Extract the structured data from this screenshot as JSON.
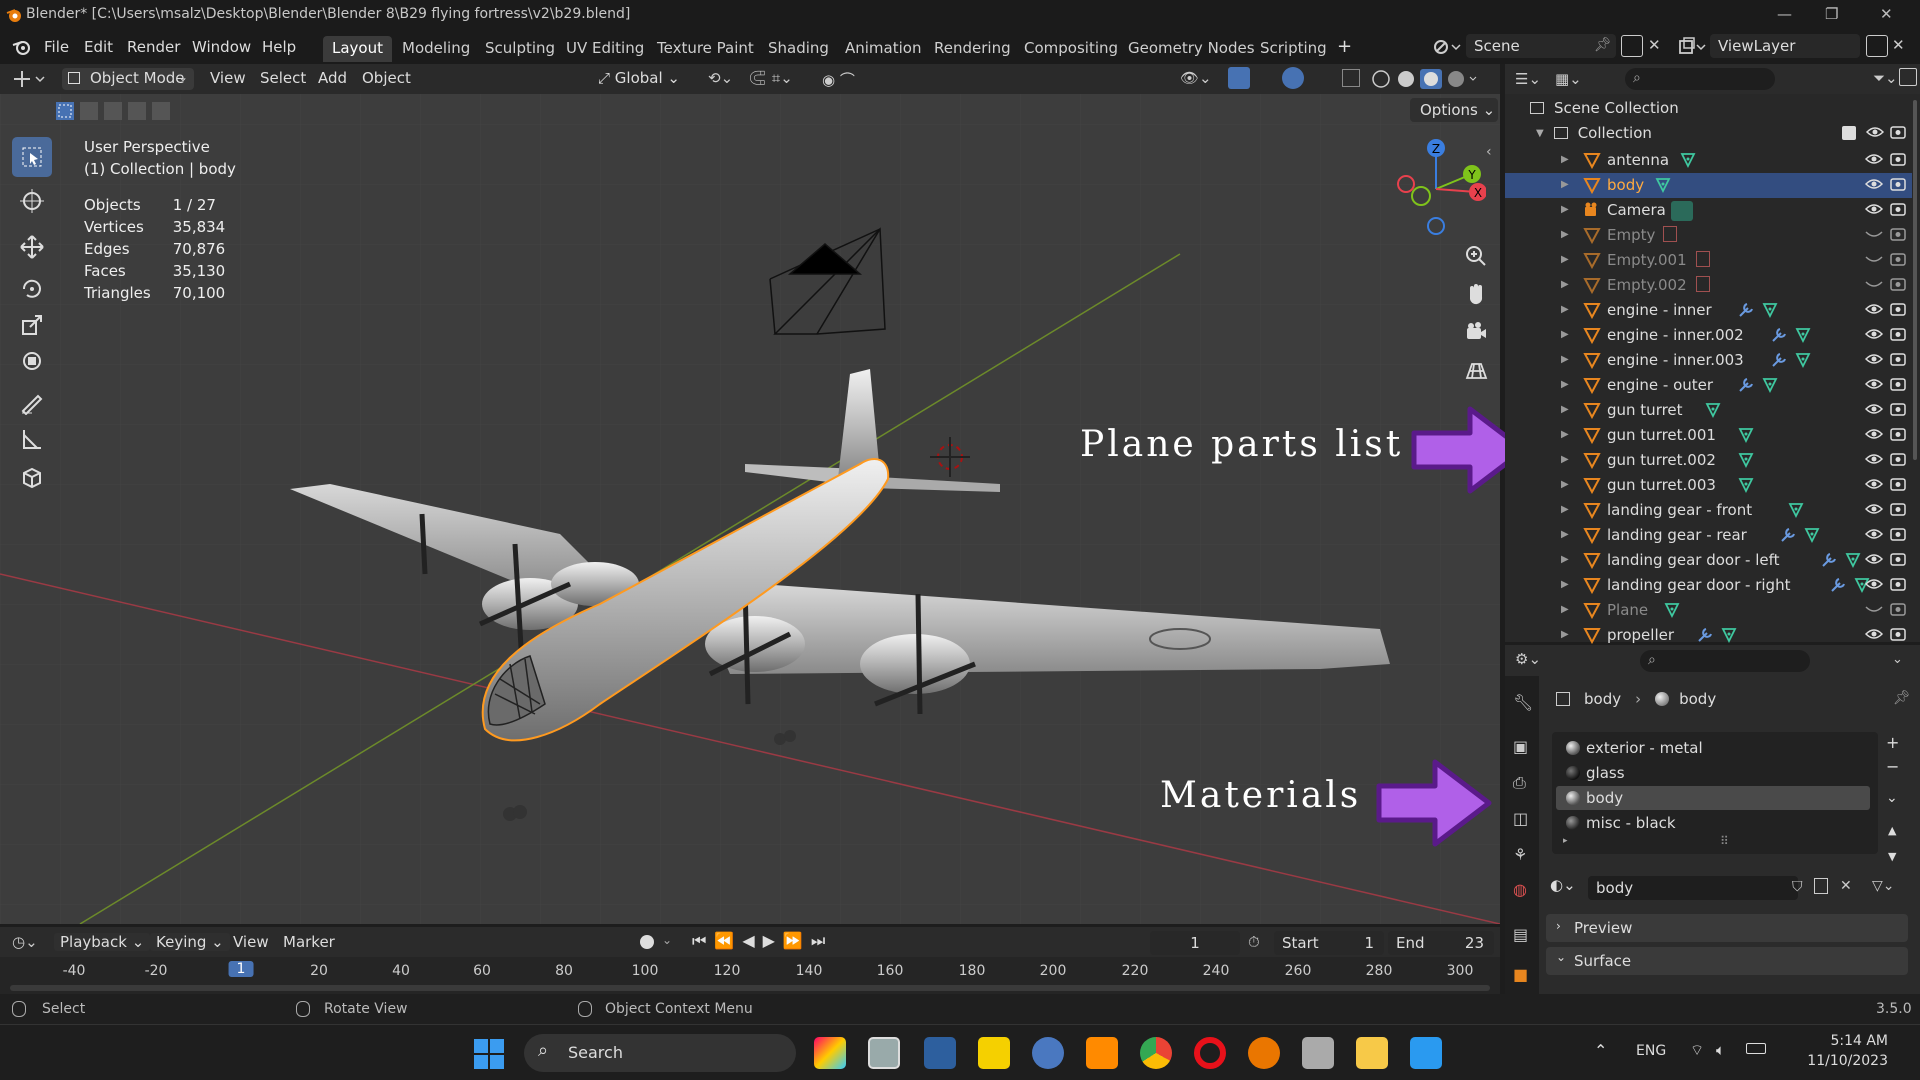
{
  "window": {
    "title": "Blender* [C:\\Users\\msalz\\Desktop\\Blender\\Blender 8\\B29 flying fortress\\v2\\b29.blend]"
  },
  "menu": [
    "File",
    "Edit",
    "Render",
    "Window",
    "Help"
  ],
  "workspaces": [
    "Layout",
    "Modeling",
    "Sculpting",
    "UV Editing",
    "Texture Paint",
    "Shading",
    "Animation",
    "Rendering",
    "Compositing",
    "Geometry Nodes",
    "Scripting"
  ],
  "scene": "Scene",
  "view_layer": "ViewLayer",
  "viewport_header": {
    "mode": "Object Mode",
    "menus": [
      "View",
      "Select",
      "Add",
      "Object"
    ],
    "transform": "Global",
    "options": "Options"
  },
  "overlay_info": {
    "perspective": "User Perspective",
    "collection": "(1) Collection | body",
    "stats": [
      {
        "label": "Objects",
        "value": "1 / 27"
      },
      {
        "label": "Vertices",
        "value": "35,834"
      },
      {
        "label": "Edges",
        "value": "70,876"
      },
      {
        "label": "Faces",
        "value": "35,130"
      },
      {
        "label": "Triangles",
        "value": "70,100"
      }
    ]
  },
  "gizmo_axes": {
    "x": "X",
    "y": "Y",
    "z": "Z"
  },
  "annotations": {
    "parts": "Plane parts list",
    "materials": "Materials"
  },
  "outliner": {
    "root": "Scene Collection",
    "collection": "Collection",
    "items": [
      {
        "name": "antenna",
        "type": "mesh",
        "selected": false,
        "dim": false
      },
      {
        "name": "body",
        "type": "mesh",
        "selected": true,
        "dim": false
      },
      {
        "name": "Camera",
        "type": "camera",
        "selected": false,
        "dim": false
      },
      {
        "name": "Empty",
        "type": "empty",
        "selected": false,
        "dim": true
      },
      {
        "name": "Empty.001",
        "type": "empty",
        "selected": false,
        "dim": true
      },
      {
        "name": "Empty.002",
        "type": "empty",
        "selected": false,
        "dim": true
      },
      {
        "name": "engine - inner",
        "type": "mesh-mod",
        "selected": false,
        "dim": false
      },
      {
        "name": "engine - inner.002",
        "type": "mesh-mod",
        "selected": false,
        "dim": false
      },
      {
        "name": "engine - inner.003",
        "type": "mesh-mod",
        "selected": false,
        "dim": false
      },
      {
        "name": "engine - outer",
        "type": "mesh-mod",
        "selected": false,
        "dim": false
      },
      {
        "name": "gun turret",
        "type": "mesh",
        "selected": false,
        "dim": false
      },
      {
        "name": "gun turret.001",
        "type": "mesh",
        "selected": false,
        "dim": false
      },
      {
        "name": "gun turret.002",
        "type": "mesh",
        "selected": false,
        "dim": false
      },
      {
        "name": "gun turret.003",
        "type": "mesh",
        "selected": false,
        "dim": false
      },
      {
        "name": "landing gear - front",
        "type": "mesh",
        "selected": false,
        "dim": false
      },
      {
        "name": "landing gear - rear",
        "type": "mesh-mod",
        "selected": false,
        "dim": false
      },
      {
        "name": "landing gear door - left",
        "type": "mesh-mod",
        "selected": false,
        "dim": false
      },
      {
        "name": "landing gear door - right",
        "type": "mesh-mod",
        "selected": false,
        "dim": false
      },
      {
        "name": "Plane",
        "type": "mesh",
        "selected": false,
        "dim": true
      },
      {
        "name": "propeller",
        "type": "mesh-mod",
        "selected": false,
        "dim": false
      }
    ]
  },
  "properties": {
    "breadcrumb_object": "body",
    "breadcrumb_material": "body",
    "materials": [
      "exterior - metal",
      "glass",
      "body",
      "misc - black"
    ],
    "selected_material": "body",
    "material_name": "body",
    "sections": [
      "Preview",
      "Surface"
    ]
  },
  "timeline": {
    "menus": [
      "Playback",
      "Keying",
      "View",
      "Marker"
    ],
    "current_frame": "1",
    "start_label": "Start",
    "start": "1",
    "end_label": "End",
    "end": "23",
    "ticks": [
      "-40",
      "-20",
      "1",
      "20",
      "40",
      "60",
      "80",
      "100",
      "120",
      "140",
      "160",
      "180",
      "200",
      "220",
      "240",
      "260",
      "280",
      "300"
    ]
  },
  "statusbar": {
    "select": "Select",
    "rotate": "Rotate View",
    "context": "Object Context Menu",
    "version": "3.5.0"
  },
  "taskbar": {
    "search": "Search",
    "language": "ENG",
    "time": "5:14 AM",
    "date": "11/10/2023"
  },
  "colors": {
    "selection_outline": "#ff9a1f",
    "active_row": "#334d80",
    "accent_purple": "#a23ee0",
    "x_axis": "#e8414d",
    "y_axis": "#7fc31b",
    "z_axis": "#3a7ee0"
  }
}
